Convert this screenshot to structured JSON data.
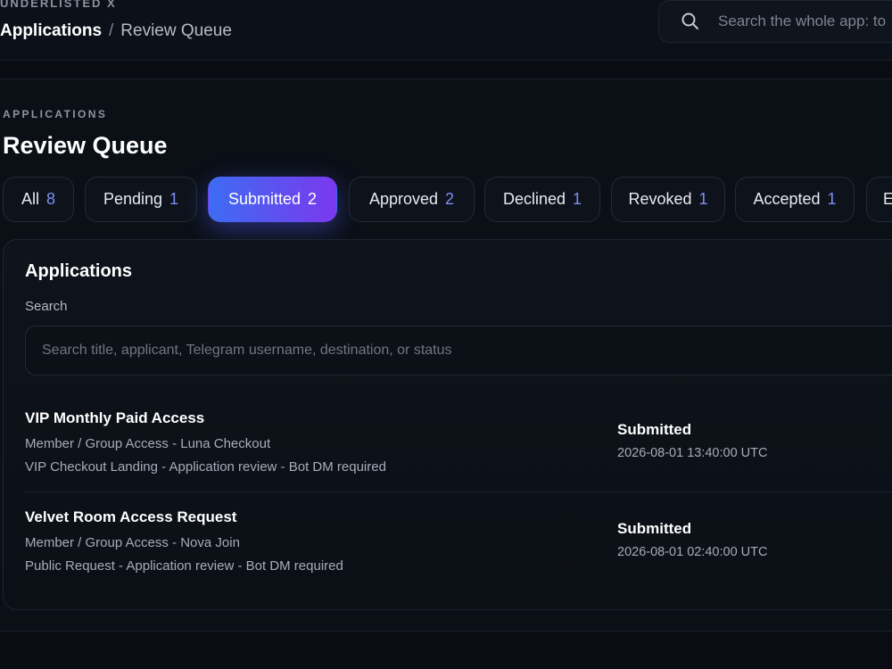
{
  "app": {
    "brand": "UNDERLISTED X"
  },
  "breadcrumb": {
    "root": "Applications",
    "separator": "/",
    "current": "Review Queue"
  },
  "global_search": {
    "placeholder": "Search the whole app: to"
  },
  "page": {
    "eyebrow": "APPLICATIONS",
    "title": "Review Queue"
  },
  "tabs": [
    {
      "label": "All",
      "count": "8"
    },
    {
      "label": "Pending",
      "count": "1"
    },
    {
      "label": "Submitted",
      "count": "2",
      "active": true
    },
    {
      "label": "Approved",
      "count": "2"
    },
    {
      "label": "Declined",
      "count": "1"
    },
    {
      "label": "Revoked",
      "count": "1"
    },
    {
      "label": "Accepted",
      "count": "1"
    },
    {
      "label": "E",
      "count": ""
    }
  ],
  "card": {
    "title": "Applications",
    "search_label": "Search",
    "search_placeholder": "Search title, applicant, Telegram username, destination, or status"
  },
  "applications": [
    {
      "title": "VIP Monthly Paid Access",
      "subtitle": "Member / Group Access - Luna Checkout",
      "meta": "VIP Checkout Landing - Application review - Bot DM required",
      "status": "Submitted",
      "timestamp": "2026-08-01 13:40:00 UTC"
    },
    {
      "title": "Velvet Room Access Request",
      "subtitle": "Member / Group Access - Nova Join",
      "meta": "Public Request - Application review - Bot DM required",
      "status": "Submitted",
      "timestamp": "2026-08-01 02:40:00 UTC"
    }
  ],
  "colors": {
    "accent_start": "#3d6cf2",
    "accent_end": "#7a39ee",
    "count": "#7b8ef5"
  },
  "icons": {
    "global_search": "search-icon"
  }
}
